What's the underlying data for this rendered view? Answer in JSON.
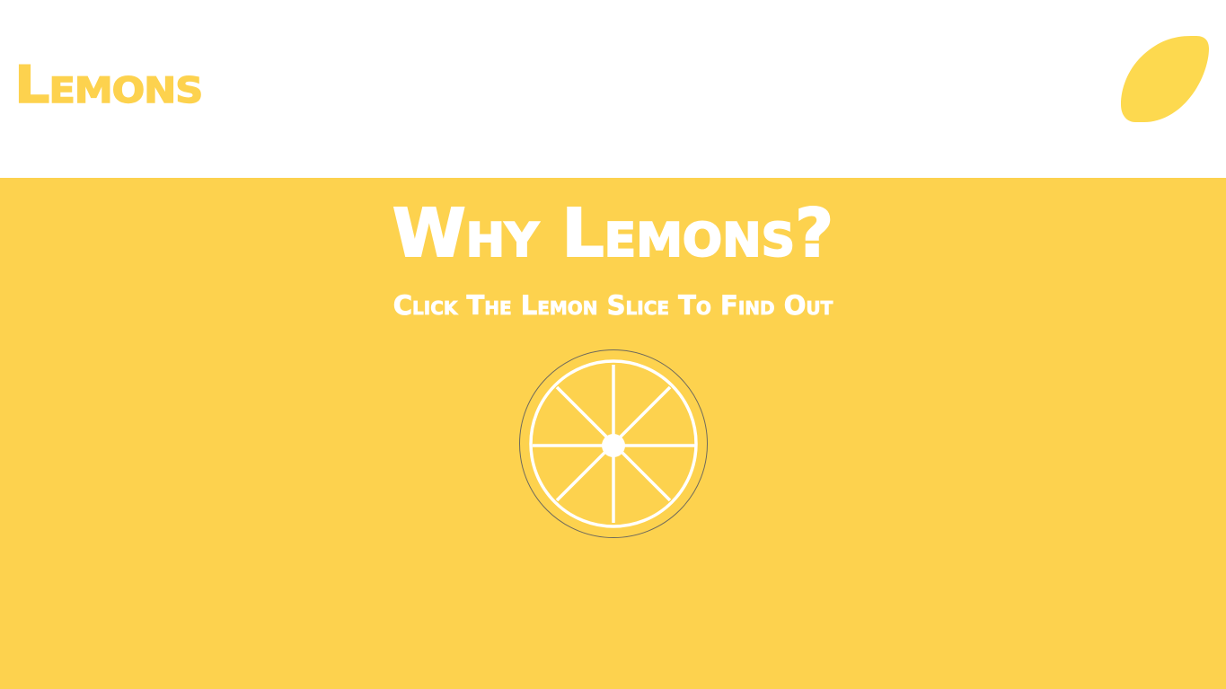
{
  "header": {
    "logo_text": "Lemons",
    "lemon_icon": "lemon-icon"
  },
  "hero": {
    "title": "Why Lemons?",
    "subtitle": "Click The Lemon Slice To Find Out",
    "slice_icon": "lemon-slice-icon"
  },
  "colors": {
    "brand_yellow": "#fdd24e",
    "white": "#ffffff"
  }
}
